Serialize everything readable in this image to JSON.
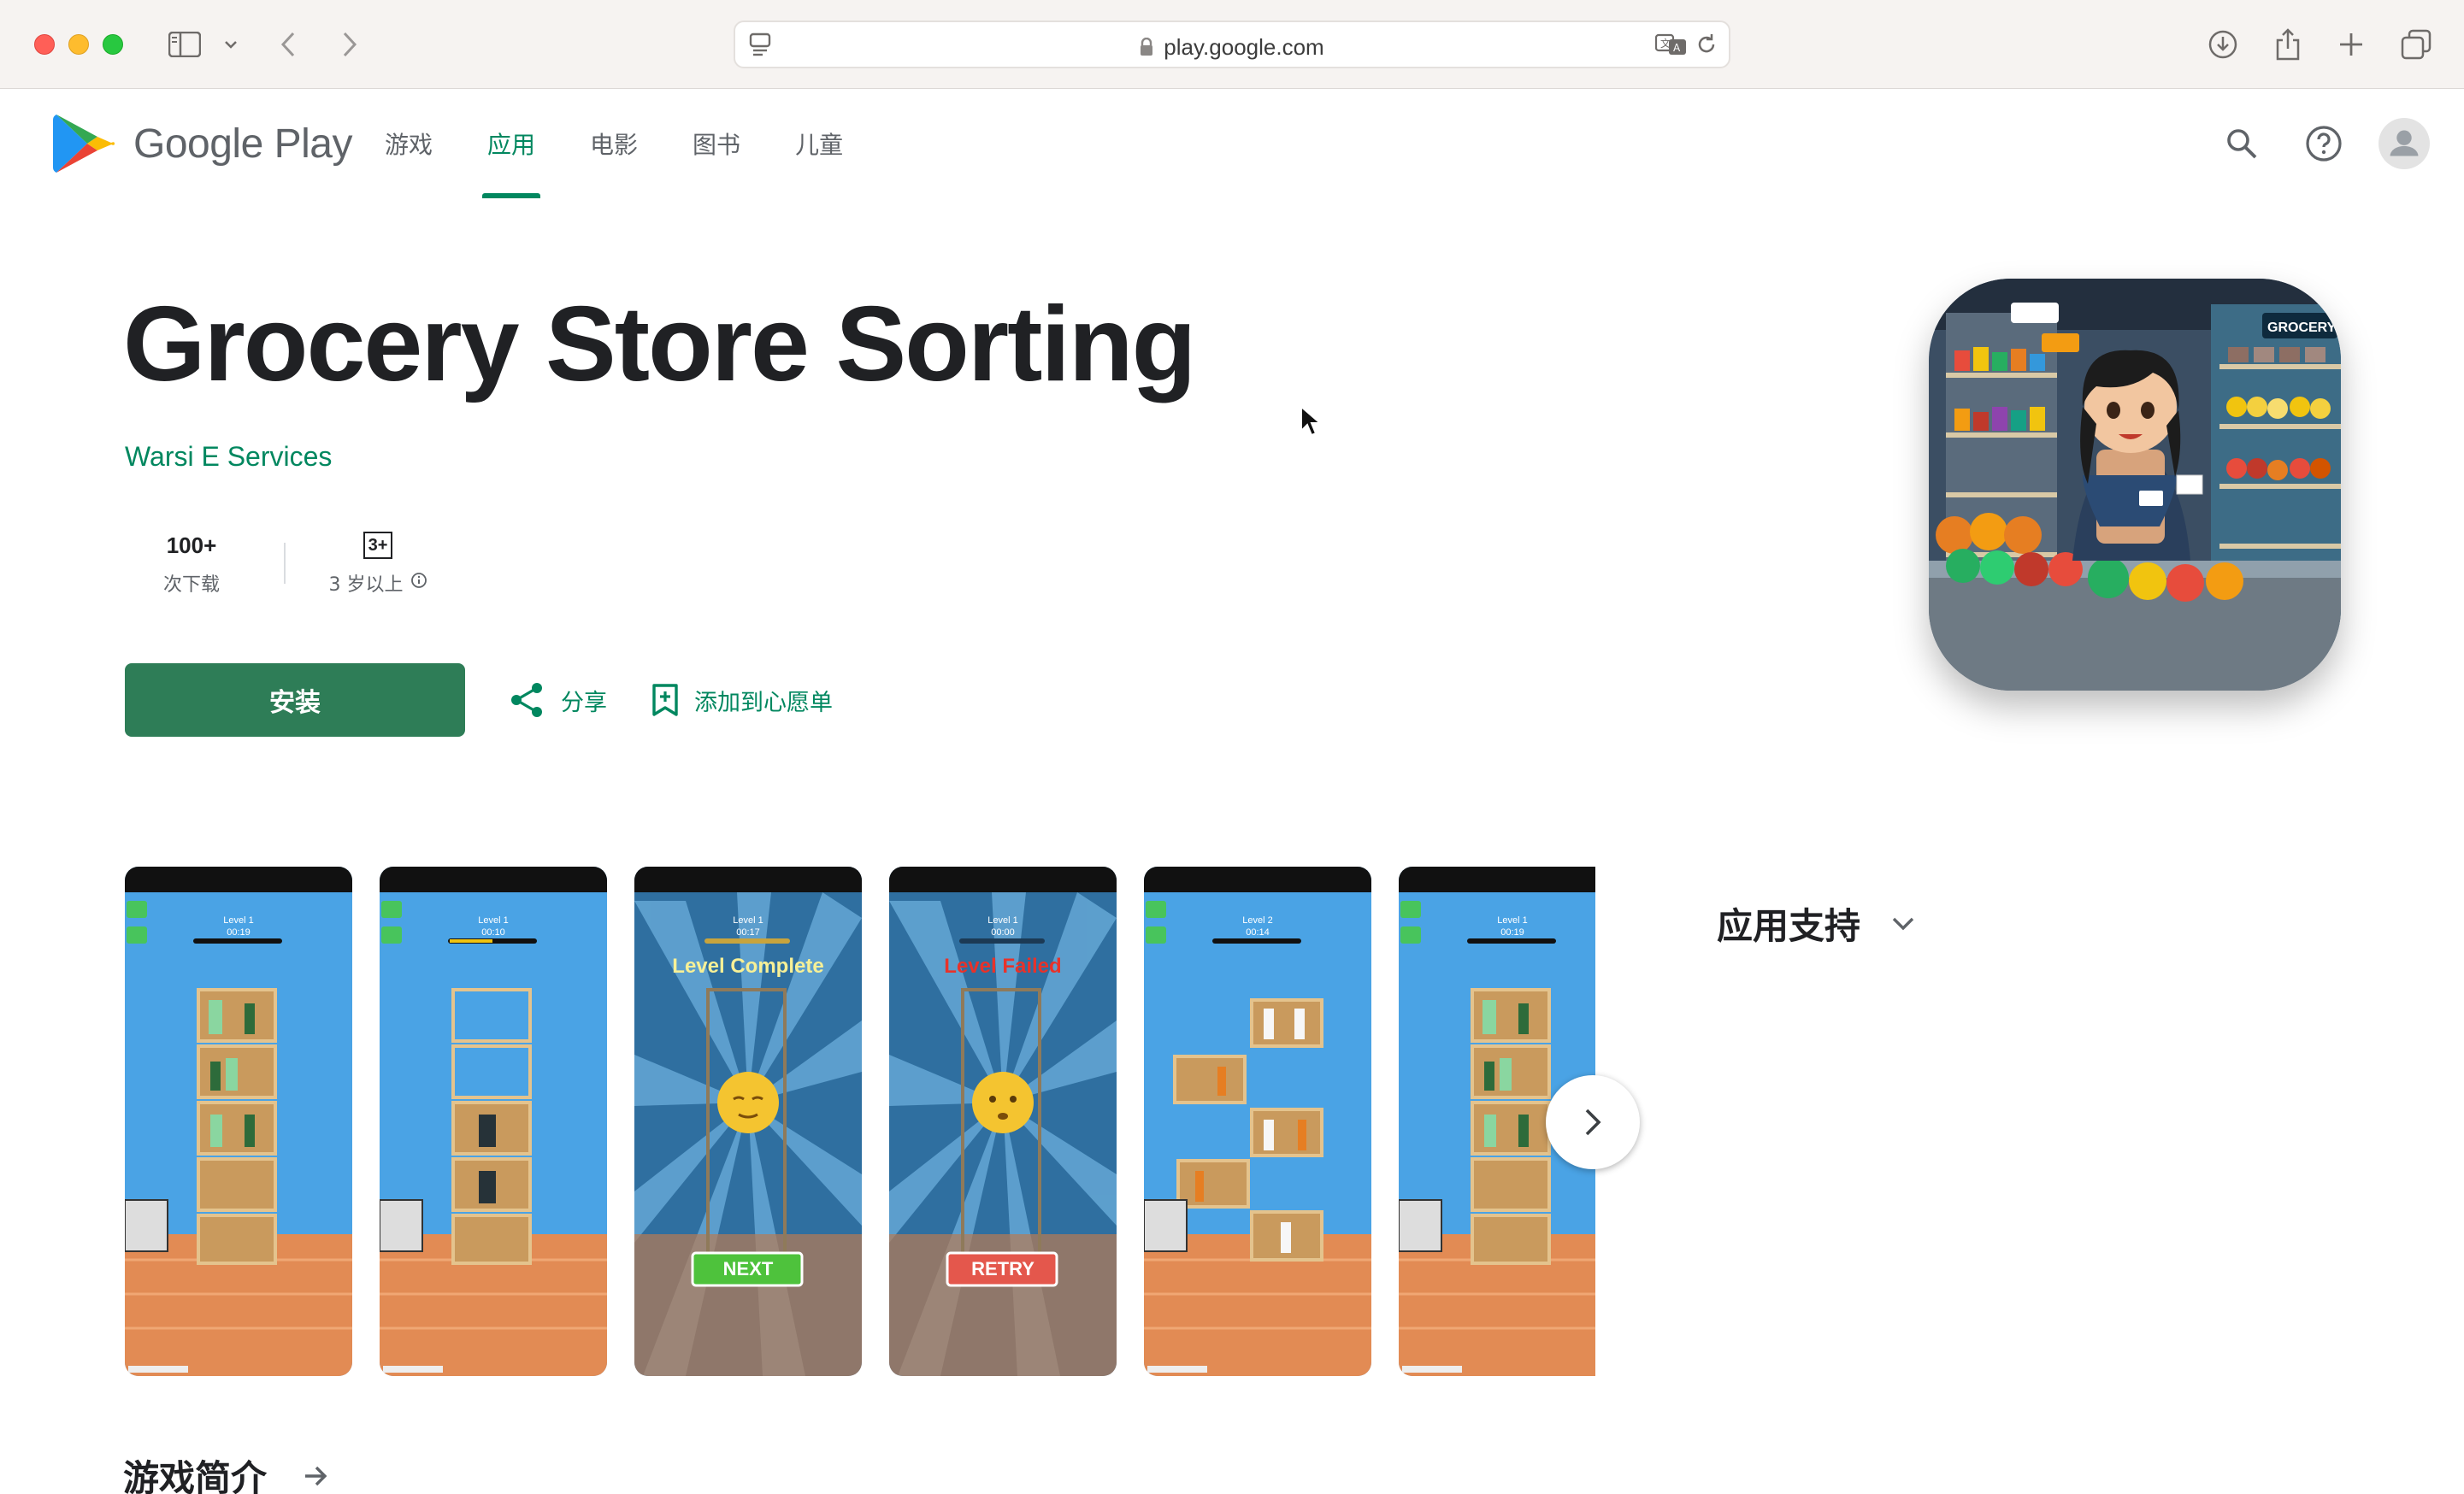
{
  "browser": {
    "url": "play.google.com"
  },
  "header": {
    "logo_text": "Google Play",
    "nav": [
      {
        "label": "游戏",
        "active": false
      },
      {
        "label": "应用",
        "active": true
      },
      {
        "label": "电影",
        "active": false
      },
      {
        "label": "图书",
        "active": false
      },
      {
        "label": "儿童",
        "active": false
      }
    ],
    "icons": [
      "search-icon",
      "help-icon",
      "account-avatar"
    ]
  },
  "app": {
    "title": "Grocery Store Sorting",
    "developer": "Warsi E Services",
    "downloads_value": "100+",
    "downloads_label": "次下载",
    "rating_badge": "3+",
    "rating_label": "3 岁以上",
    "install_label": "安装",
    "share_label": "分享",
    "wishlist_label": "添加到心愿单"
  },
  "screenshots": [
    {
      "level": "Level 1",
      "timer": "00:19",
      "banner": "",
      "button": ""
    },
    {
      "level": "Level 1",
      "timer": "00:10",
      "banner": "",
      "button": ""
    },
    {
      "level": "Level 1",
      "timer": "00:17",
      "banner": "Level Complete",
      "button": "NEXT"
    },
    {
      "level": "Level 1",
      "timer": "00:00",
      "banner": "Level Failed",
      "button": "RETRY"
    },
    {
      "level": "Level 2",
      "timer": "00:14",
      "banner": "",
      "button": ""
    },
    {
      "level": "Level 1",
      "timer": "00:19",
      "banner": "",
      "button": ""
    }
  ],
  "sections": {
    "support_title": "应用支持",
    "about_title": "游戏简介"
  },
  "colors": {
    "accent": "#01875f",
    "install_bg": "#2e7d57"
  }
}
